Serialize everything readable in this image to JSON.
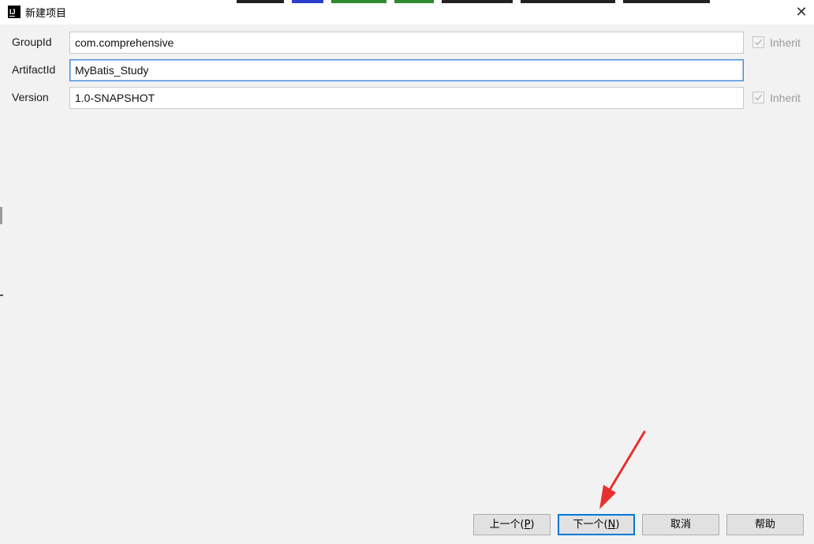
{
  "window": {
    "title": "新建项目",
    "icon_text": "IJ"
  },
  "form": {
    "group_id": {
      "label": "GroupId",
      "value": "com.comprehensive",
      "inherit_label": "Inherit",
      "inherit_checked": true
    },
    "artifact_id": {
      "label": "ArtifactId",
      "value": "MyBatis_Study"
    },
    "version": {
      "label": "Version",
      "value": "1.0-SNAPSHOT",
      "inherit_label": "Inherit",
      "inherit_checked": true
    }
  },
  "buttons": {
    "previous": {
      "label": "上一个(",
      "mnemonic": "P",
      "suffix": ")"
    },
    "next": {
      "label": "下一个(",
      "mnemonic": "N",
      "suffix": ")"
    },
    "cancel": {
      "label": "取消"
    },
    "help": {
      "label": "帮助"
    }
  },
  "colors": {
    "dialog_bg": "#f2f2f2",
    "focus_border": "#3f8bd6",
    "primary_button_border": "#0078d7",
    "annotation_arrow": "#e83030"
  },
  "annotation": {
    "type": "arrow",
    "target": "next-button"
  }
}
